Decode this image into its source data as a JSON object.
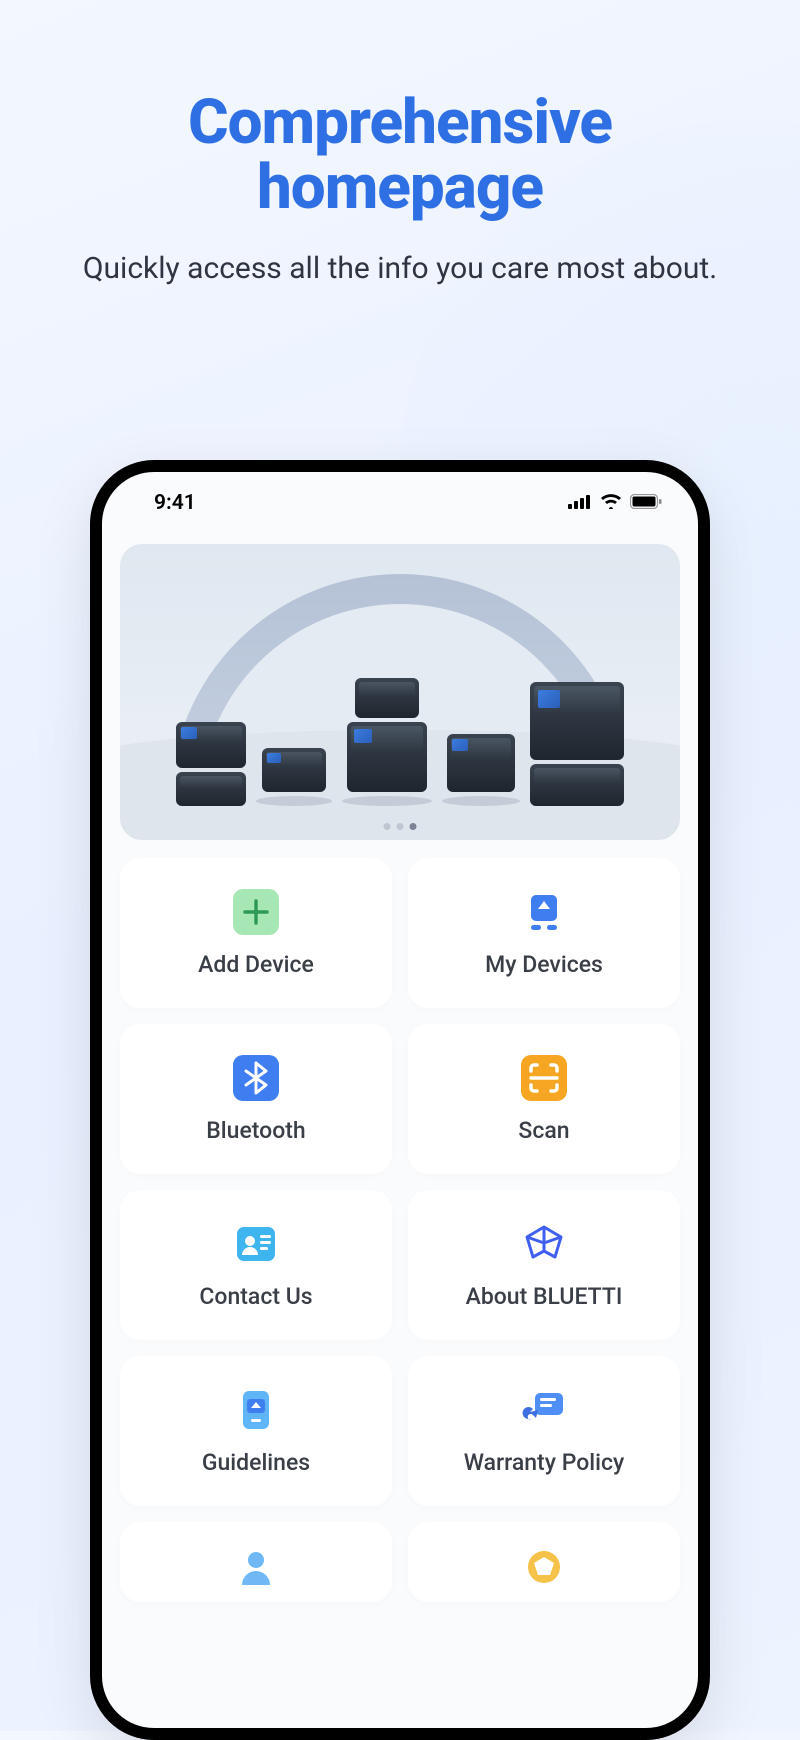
{
  "hero": {
    "title": "Comprehensive homepage",
    "subtitle": "Quickly access all the info you care most about."
  },
  "status": {
    "time": "9:41"
  },
  "grid": {
    "items": [
      {
        "label": "Add Device",
        "icon": "plus-icon"
      },
      {
        "label": "My Devices",
        "icon": "device-icon"
      },
      {
        "label": "Bluetooth",
        "icon": "bluetooth-icon"
      },
      {
        "label": "Scan",
        "icon": "scan-icon"
      },
      {
        "label": "Contact Us",
        "icon": "contact-icon"
      },
      {
        "label": "About BLUETTI",
        "icon": "about-icon"
      },
      {
        "label": "Guidelines",
        "icon": "guidelines-icon"
      },
      {
        "label": "Warranty Policy",
        "icon": "warranty-icon"
      }
    ]
  }
}
